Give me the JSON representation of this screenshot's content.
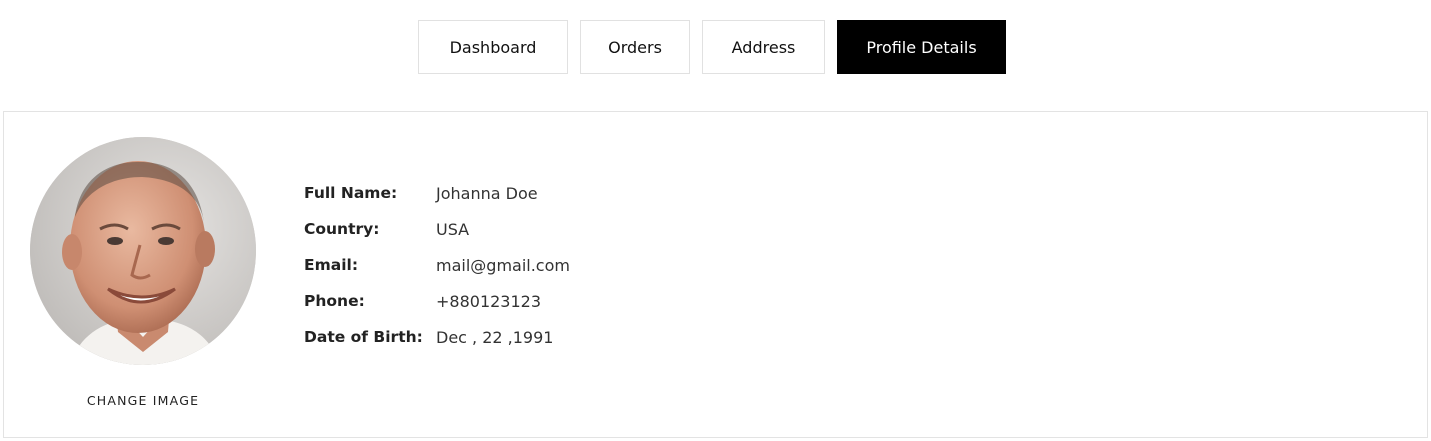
{
  "tabs": [
    {
      "label": "Dashboard",
      "active": false
    },
    {
      "label": "Orders",
      "active": false
    },
    {
      "label": "Address",
      "active": false
    },
    {
      "label": "Profile Details",
      "active": true
    }
  ],
  "profile": {
    "change_image_label": "CHANGE IMAGE",
    "fields": [
      {
        "label": "Full Name:",
        "value": "Johanna Doe"
      },
      {
        "label": "Country:",
        "value": "USA"
      },
      {
        "label": "Email:",
        "value": "mail@gmail.com"
      },
      {
        "label": "Phone:",
        "value": "+880123123"
      },
      {
        "label": "Date of Birth:",
        "value": "Dec , 22 ,1991"
      }
    ]
  },
  "colors": {
    "active_tab_bg": "#000000",
    "active_tab_text": "#ffffff",
    "border": "#e1e1e1"
  }
}
